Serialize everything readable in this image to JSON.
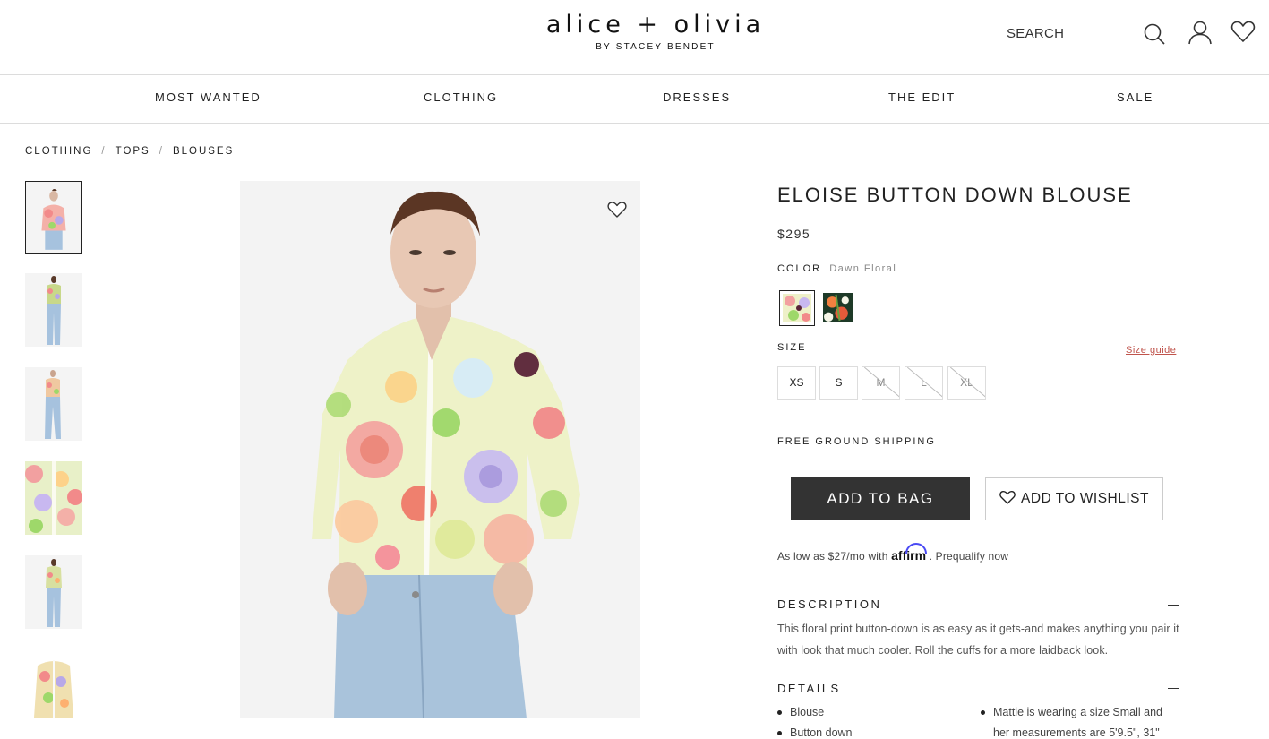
{
  "header": {
    "logo": "alice + olivia",
    "logo_sub": "BY STACEY BENDET",
    "search_placeholder": "SEARCH",
    "icons": [
      "search-icon",
      "account-icon",
      "heart-icon"
    ]
  },
  "nav": {
    "items": [
      "MOST WANTED",
      "CLOTHING",
      "DRESSES",
      "THE EDIT",
      "SALE"
    ]
  },
  "breadcrumb": [
    "CLOTHING",
    "TOPS",
    "BLOUSES"
  ],
  "product": {
    "title": "ELOISE BUTTON DOWN BLOUSE",
    "price": "$295",
    "color_label": "COLOR",
    "color_value": "Dawn Floral",
    "size_label": "SIZE",
    "size_guide": "Size guide",
    "sizes": [
      {
        "label": "XS",
        "available": true
      },
      {
        "label": "S",
        "available": true
      },
      {
        "label": "M",
        "available": false
      },
      {
        "label": "L",
        "available": false
      },
      {
        "label": "XL",
        "available": false
      }
    ],
    "shipping": "FREE GROUND SHIPPING",
    "add_to_bag": "ADD TO BAG",
    "add_to_wishlist": "ADD TO WISHLIST",
    "affirm_prefix": "As low as $27/mo with",
    "affirm_brand": "affirm",
    "affirm_suffix": ". Prequalify now",
    "description_heading": "DESCRIPTION",
    "description_text": "This floral print button-down is as easy as it gets-and makes anything you pair it with look that much cooler. Roll the cuffs for a more laidback look.",
    "details_heading": "DETAILS",
    "details_left": [
      "Blouse",
      "Button down"
    ],
    "details_right": [
      "Mattie is wearing a size Small and her measurements are 5'9.5\", 31\""
    ]
  },
  "colors": {
    "brand_dark": "#333333",
    "link_red": "#c0544c",
    "affirm_blue": "#4a4af4"
  }
}
